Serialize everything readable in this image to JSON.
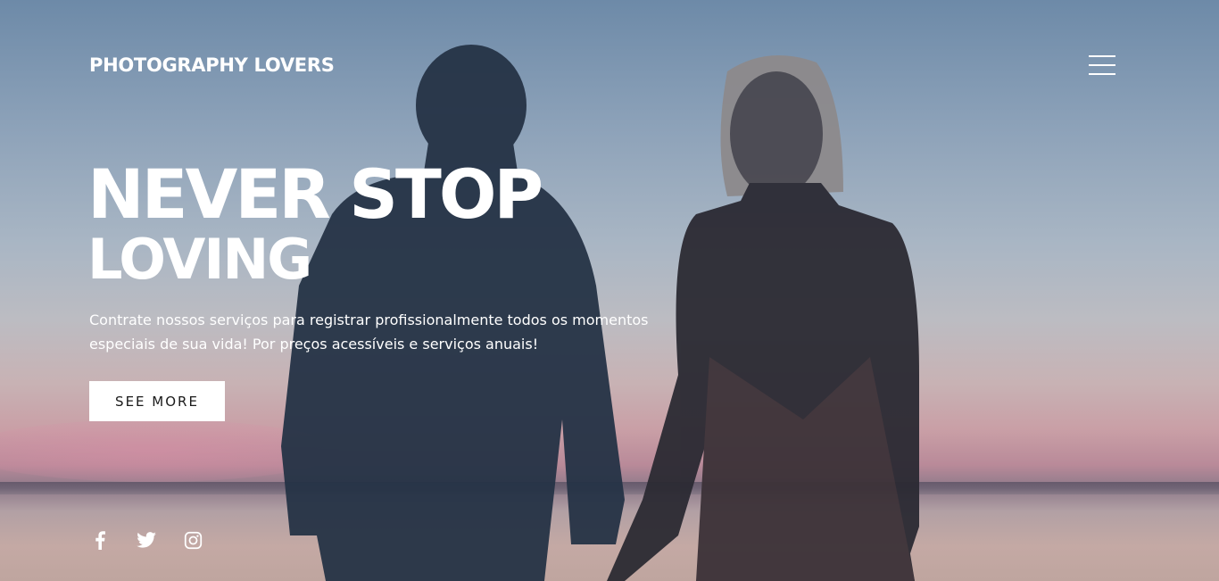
{
  "header": {
    "brand": "PHOTOGRAPHY LOVERS",
    "menu_icon": "hamburger-menu-icon"
  },
  "hero": {
    "headline_line1": "NEVER STOP",
    "headline_line2": "LOVING",
    "subtitle": "Contrate nossos serviços para registrar profissionalmente todos os momentos especiais de sua vida! Por preços acessíveis e serviços anuais!",
    "cta_label": "SEE MORE"
  },
  "social": [
    {
      "icon": "facebook-icon"
    },
    {
      "icon": "twitter-icon"
    },
    {
      "icon": "instagram-icon"
    }
  ],
  "colors": {
    "text": "#ffffff",
    "button_bg": "#ffffff",
    "button_text": "#1a1a1a"
  }
}
